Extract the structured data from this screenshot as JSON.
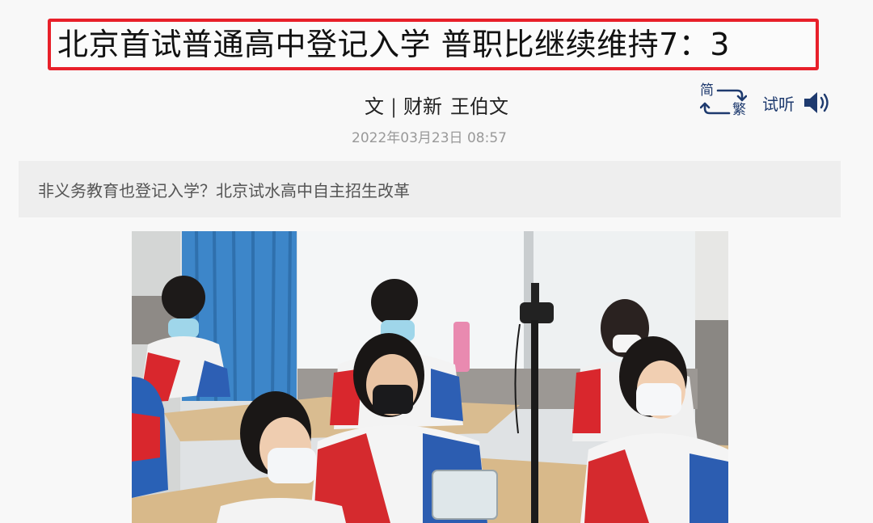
{
  "article": {
    "title": "北京首试普通高中登记入学 普职比继续维持7：3",
    "byline_prefix": "文",
    "byline_separator": "|",
    "source": "财新",
    "author": "王伯文",
    "date": "2022年03月23日 08:57",
    "summary": "非义务教育也登记入学？北京试水高中自主招生改革"
  },
  "toolbar": {
    "convert_simplified": "简",
    "convert_traditional": "繁",
    "listen_label": "试听",
    "icons": [
      "convert-arrows-icon",
      "speaker-icon"
    ]
  },
  "colors": {
    "highlight_border": "#e8202a",
    "toolbar_blue": "#1e3a6e",
    "summary_bg": "#eeeeee",
    "date_gray": "#999999"
  }
}
